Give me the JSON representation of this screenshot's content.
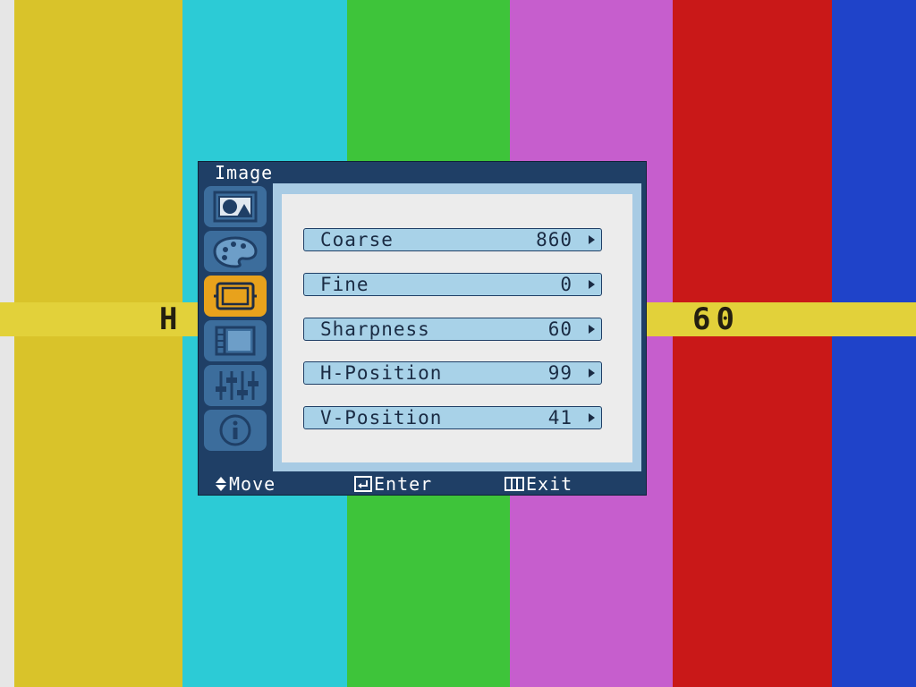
{
  "background": {
    "bar_colors": [
      "#d9c32a",
      "#2ccbd6",
      "#3ec43a",
      "#c65ecd",
      "#c91818",
      "#1f43c9"
    ],
    "edge_color": "#e6e6e6",
    "band_color": "#e2d13a",
    "band_left_text": "H",
    "band_right_text": "60"
  },
  "osd": {
    "title": "Image",
    "sidebar": [
      {
        "name": "picture",
        "icon": "picture-icon",
        "active": false
      },
      {
        "name": "color",
        "icon": "palette-icon",
        "active": false
      },
      {
        "name": "image",
        "icon": "image-size-icon",
        "active": true
      },
      {
        "name": "osd",
        "icon": "osd-panel-icon",
        "active": false
      },
      {
        "name": "setup",
        "icon": "sliders-icon",
        "active": false
      },
      {
        "name": "info",
        "icon": "info-icon",
        "active": false
      }
    ],
    "items": [
      {
        "label": "Coarse",
        "value": "860"
      },
      {
        "label": "Fine",
        "value": "0"
      },
      {
        "label": "Sharpness",
        "value": "60"
      },
      {
        "label": "H-Position",
        "value": "99"
      },
      {
        "label": "V-Position",
        "value": "41"
      }
    ],
    "footer": {
      "move": "Move",
      "enter": "Enter",
      "exit": "Exit"
    },
    "colors": {
      "frame": "#1f3f66",
      "active_icon": "#e8a21c",
      "item_bg": "#a8d2e8"
    }
  }
}
